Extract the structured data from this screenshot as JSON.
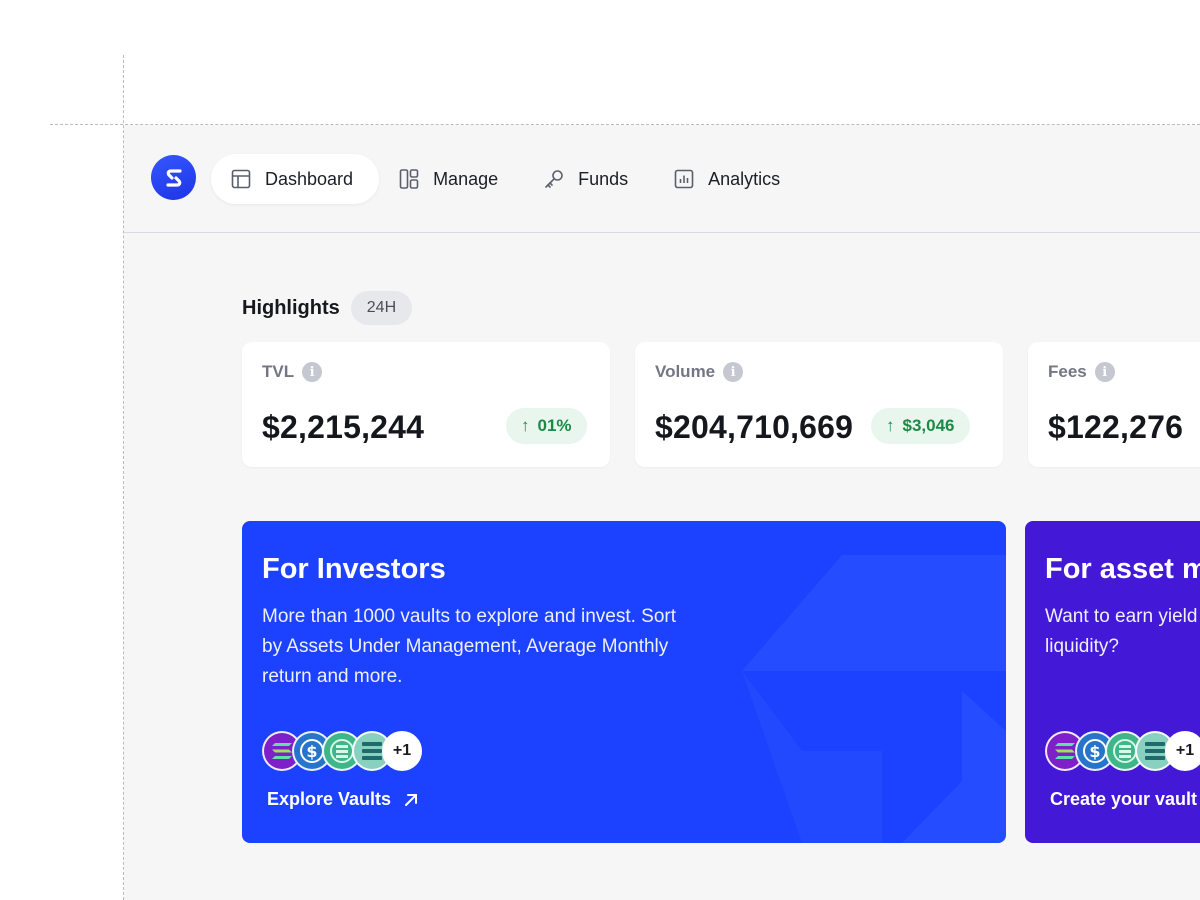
{
  "nav": {
    "logo": "logo-icon",
    "items": [
      {
        "label": "Dashboard",
        "icon": "layout-icon",
        "active": true
      },
      {
        "label": "Manage",
        "icon": "grid-icon",
        "active": false
      },
      {
        "label": "Funds",
        "icon": "key-icon",
        "active": false
      },
      {
        "label": "Analytics",
        "icon": "bar-chart-icon",
        "active": false
      }
    ]
  },
  "highlights": {
    "title": "Highlights",
    "period": "24H",
    "cards": [
      {
        "label": "TVL",
        "value": "$2,215,244",
        "delta": "01%",
        "delta_direction": "up"
      },
      {
        "label": "Volume",
        "value": "$204,710,669",
        "delta": "$3,046",
        "delta_direction": "up"
      },
      {
        "label": "Fees",
        "value": "$122,276"
      }
    ]
  },
  "promos": [
    {
      "title": "For Investors",
      "body": "More than 1000 vaults to explore and invest. Sort by Assets Under Management, Average Monthly return and more.",
      "more_count": "+1",
      "link": "Explore Vaults"
    },
    {
      "title": "For asset managers",
      "body": "Want to earn yield with your liquidity?",
      "more_count": "+1",
      "link": "Create your vault"
    }
  ],
  "colors": {
    "accent": "#1c42ff",
    "manager_card": "#4318d6",
    "positive": "#1c8a47",
    "page_bg": "#f6f6f7"
  }
}
